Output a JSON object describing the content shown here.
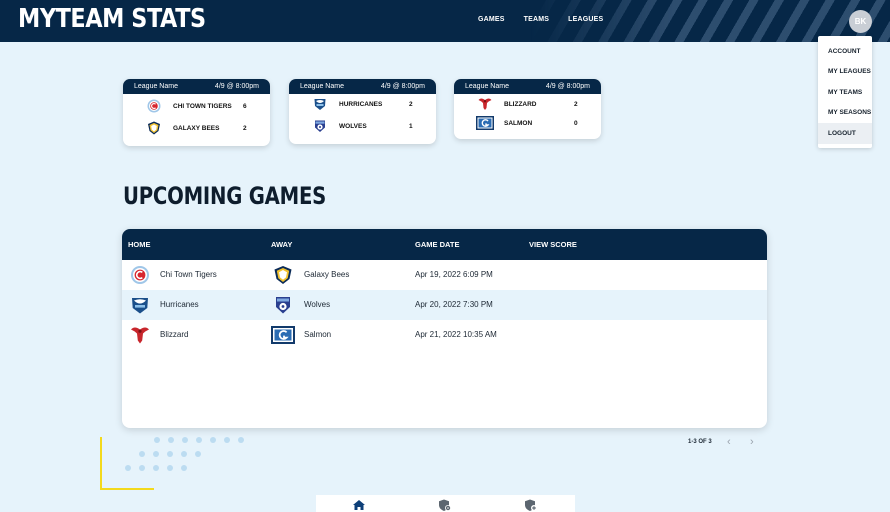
{
  "header": {
    "brand": "MYTEAM STATS",
    "nav": [
      "GAMES",
      "TEAMS",
      "LEAGUES"
    ],
    "avatar_initials": "BK",
    "colors": {
      "navy": "#062747",
      "background": "#e6f3fb",
      "accent_yellow": "#f3d91c"
    }
  },
  "user_menu": {
    "items": [
      "ACCOUNT",
      "MY LEAGUES",
      "MY TEAMS",
      "MY SEASONS",
      "LOGOUT"
    ],
    "highlighted": "LOGOUT"
  },
  "score_cards": [
    {
      "league": "League Name",
      "datetime": "4/9 @ 8:00pm",
      "teams": [
        {
          "name": "CHI TOWN TIGERS",
          "score": "6",
          "icon": "chicago-fire-crest-icon"
        },
        {
          "name": "GALAXY BEES",
          "score": "2",
          "icon": "la-galaxy-crest-icon"
        }
      ]
    },
    {
      "league": "League Name",
      "datetime": "4/9 @ 8:00pm",
      "teams": [
        {
          "name": "HURRICANES",
          "score": "2",
          "icon": "hurricanes-crest-icon"
        },
        {
          "name": "WOLVES",
          "score": "1",
          "icon": "wolves-crest-icon"
        }
      ]
    },
    {
      "league": "League Name",
      "datetime": "4/9 @ 8:00pm",
      "teams": [
        {
          "name": "BLIZZARD",
          "score": "2",
          "icon": "blizzard-phoenix-icon"
        },
        {
          "name": "SALMON",
          "score": "0",
          "icon": "salmon-crest-icon"
        }
      ]
    }
  ],
  "upcoming": {
    "title": "UPCOMING GAMES",
    "columns": [
      "HOME",
      "AWAY",
      "GAME DATE",
      "VIEW SCORE"
    ],
    "rows": [
      {
        "home": "Chi Town Tigers",
        "away": "Galaxy Bees",
        "date": "Apr 19, 2022 6:09 PM"
      },
      {
        "home": "Hurricanes",
        "away": "Wolves",
        "date": "Apr 20, 2022 7:30 PM"
      },
      {
        "home": "Blizzard",
        "away": "Salmon",
        "date": "Apr 21, 2022 10:35 AM"
      }
    ],
    "pagination": {
      "label": "1-3 OF 3",
      "prev_icon": "chevron-left-icon",
      "next_icon": "chevron-right-icon"
    }
  },
  "bottom_tabs": [
    {
      "icon": "home-icon",
      "active": true
    },
    {
      "icon": "shield-settings-icon",
      "active": false
    },
    {
      "icon": "shield-add-icon",
      "active": false
    }
  ]
}
